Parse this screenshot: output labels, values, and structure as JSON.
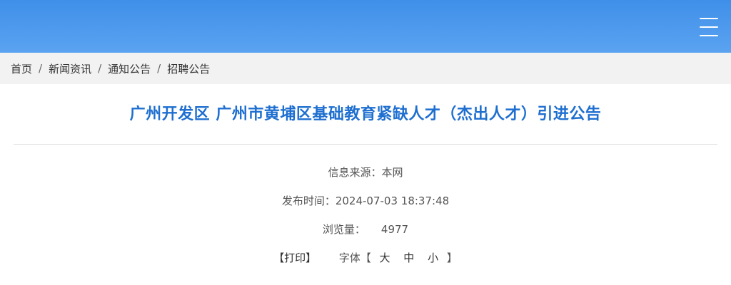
{
  "header": {
    "menu_icon": "hamburger-menu-icon",
    "gradient_top": "#3f8fe9",
    "gradient_bottom": "#5ba3f1"
  },
  "breadcrumb": {
    "items": [
      "首页",
      "新闻资讯",
      "通知公告",
      "招聘公告"
    ],
    "separator": "/"
  },
  "article": {
    "title": "广州开发区 广州市黄埔区基础教育紧缺人才（杰出人才）引进公告",
    "title_color": "#1e6fd0",
    "source_label": "信息来源：",
    "source_value": "本网",
    "time_label": "发布时间：",
    "time_value": "2024-07-03 18:37:48",
    "views_label": "浏览量：",
    "views_value": "4977"
  },
  "tools": {
    "print_label": "【打印】",
    "font_label": "字体【",
    "font_large": "大",
    "font_medium": "中",
    "font_small": "小",
    "font_close": "】"
  }
}
